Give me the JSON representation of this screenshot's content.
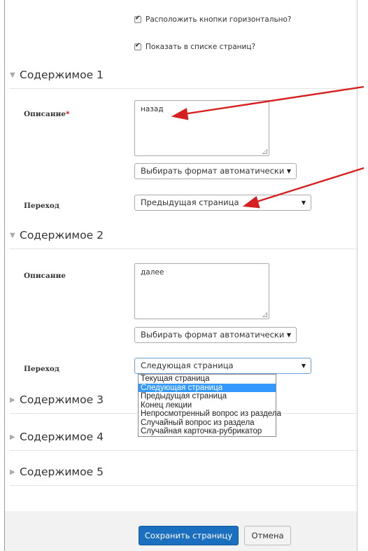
{
  "options": {
    "horizontal_buttons": "Расположить кнопки горизонтально?",
    "show_in_page_list": "Показать в списке страниц?"
  },
  "content1": {
    "header": "Содержимое 1",
    "description_label": "Описание",
    "required_mark": "*",
    "description_value": "назад",
    "format_select": "Выбирать формат автоматически",
    "transition_label": "Переход",
    "transition_value": "Предыдущая страница"
  },
  "content2": {
    "header": "Содержимое 2",
    "description_label": "Описание",
    "description_value": "далее",
    "format_select": "Выбирать формат автоматически",
    "transition_label": "Переход",
    "transition_value": "Следующая страница"
  },
  "dropdown_options": [
    "Текущая страница",
    "Следующая страница",
    "Предыдущая страница",
    "Конец лекции",
    "Непросмотренный вопрос из раздела",
    "Случайный вопрос из раздела",
    "Случайная карточка-рубрикатор"
  ],
  "content3": {
    "header": "Содержимое 3"
  },
  "content4": {
    "header": "Содержимое 4"
  },
  "content5": {
    "header": "Содержимое 5"
  },
  "buttons": {
    "save": "Сохранить страницу",
    "cancel": "Отмена"
  },
  "colors": {
    "primary_button": "#1b6fbf",
    "highlight": "#3399ff",
    "arrow": "#d62020",
    "required": "#cc0000"
  }
}
